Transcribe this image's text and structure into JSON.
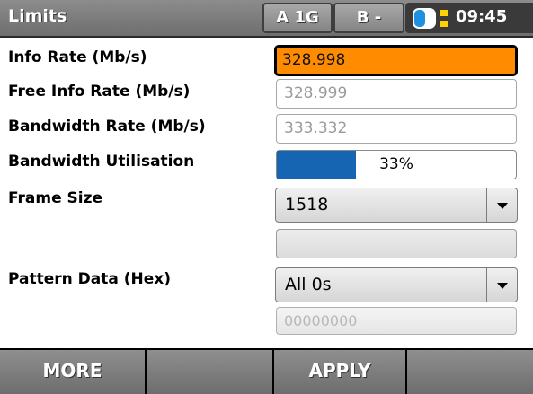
{
  "header": {
    "title": "Limits",
    "port_a": "A 1G",
    "port_b": "B -",
    "time": "09:45",
    "status_icon": "battery-icon"
  },
  "fields": {
    "info_rate": {
      "label": "Info Rate (Mb/s)",
      "value": "328.998"
    },
    "free_info_rate": {
      "label": "Free Info Rate (Mb/s)",
      "value": "328.999"
    },
    "bandwidth_rate": {
      "label": "Bandwidth Rate (Mb/s)",
      "value": "333.332"
    },
    "bandwidth_utilisation": {
      "label": "Bandwidth Utilisation",
      "value": "33%",
      "fraction": 0.33
    },
    "frame_size": {
      "label": "Frame Size",
      "value": "1518"
    },
    "pattern_data": {
      "label": "Pattern Data (Hex)",
      "value": "All 0s",
      "hex_value": "00000000"
    }
  },
  "softkeys": {
    "more": "MORE",
    "key2": "",
    "apply": "APPLY",
    "key4": ""
  },
  "colors": {
    "active_field": "#ff8c00",
    "progress": "#1665b3",
    "header": "#7a7a7a"
  }
}
